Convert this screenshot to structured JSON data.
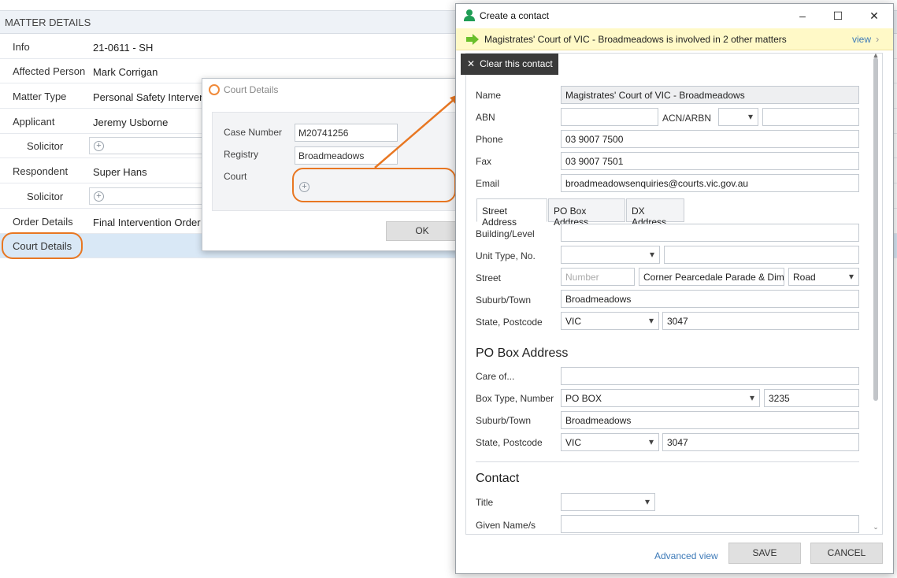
{
  "matter": {
    "header": "MATTER DETAILS",
    "rows": [
      {
        "label": "Info",
        "value": "21-0611 - SH"
      },
      {
        "label": "Affected Person",
        "value": "Mark Corrigan"
      },
      {
        "label": "Matter Type",
        "value": "Personal Safety Interven"
      },
      {
        "label": "Applicant",
        "value": "Jeremy Usborne"
      },
      {
        "label": "Solicitor",
        "value": ""
      },
      {
        "label": "Respondent",
        "value": "Super Hans"
      },
      {
        "label": "Solicitor",
        "value": ""
      },
      {
        "label": "Order Details",
        "value": "Final Intervention Order"
      },
      {
        "label": "Court Details",
        "value": ""
      }
    ]
  },
  "court_dialog": {
    "title": "Court Details",
    "case_number_label": "Case Number",
    "case_number": "M20741256",
    "registry_label": "Registry",
    "registry": "Broadmeadows",
    "court_label": "Court",
    "ok_label": "OK"
  },
  "contact": {
    "title": "Create a contact",
    "banner_text": "Magistrates' Court of VIC - Broadmeadows is involved in 2 other matters",
    "banner_link": "view",
    "clear_label": "Clear this contact",
    "name_label": "Name",
    "name": "Magistrates' Court of VIC - Broadmeadows",
    "abn_label": "ABN",
    "abn": "",
    "acn_label": "ACN/ARBN",
    "phone_label": "Phone",
    "phone": "03 9007 7500",
    "fax_label": "Fax",
    "fax": "03 9007 7501",
    "email_label": "Email",
    "email": "broadmeadowsenquiries@courts.vic.gov.au",
    "tabs": [
      "Street Address",
      "PO Box Address",
      "DX Address"
    ],
    "street": {
      "building_label": "Building/Level",
      "unit_label": "Unit Type, No.",
      "street_label": "Street",
      "number_placeholder": "Number",
      "street_name": "Corner Pearcedale Parade & Dimboola Road",
      "street_type": "Road",
      "suburb_label": "Suburb/Town",
      "suburb": "Broadmeadows",
      "state_label": "State, Postcode",
      "state": "VIC",
      "postcode": "3047"
    },
    "pobox": {
      "heading": "PO Box Address",
      "care_label": "Care of...",
      "box_label": "Box Type, Number",
      "box_type": "PO BOX",
      "box_number": "3235",
      "suburb_label": "Suburb/Town",
      "suburb": "Broadmeadows",
      "state_label": "State, Postcode",
      "state": "VIC",
      "postcode": "3047"
    },
    "contact_section": {
      "heading": "Contact",
      "title_label": "Title",
      "given_label": "Given Name/s"
    },
    "advanced_link": "Advanced view",
    "save_label": "SAVE",
    "cancel_label": "CANCEL"
  },
  "colors": {
    "annotation": "#e87722",
    "banner_bg": "#fff9c7",
    "banner_arrow": "#6abf2a",
    "selected_row": "#d9e8f6",
    "link": "#3d7ab8"
  }
}
